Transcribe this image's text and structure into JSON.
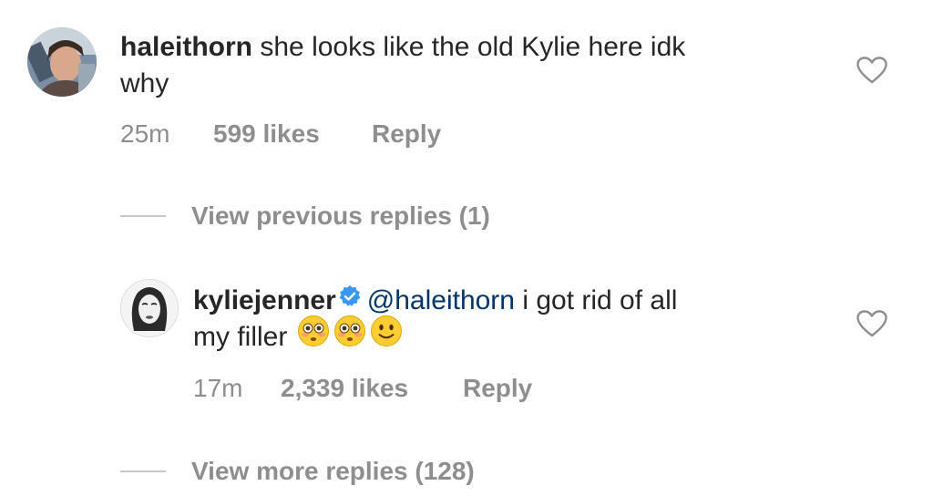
{
  "comments": [
    {
      "username": "haleithorn",
      "text_line1": "she looks like the old Kylie here idk",
      "text_line2": "why",
      "time": "25m",
      "likes": "599 likes",
      "reply": "Reply",
      "avatar_icon": "avatar-photo"
    },
    {
      "username": "kyliejenner",
      "verified": true,
      "mention": "@haleithorn",
      "text_line1": "i got rid of all",
      "text_line2": "my filler",
      "emojis": [
        "flushed-face",
        "flushed-face",
        "slightly-smiling-face"
      ],
      "time": "17m",
      "likes": "2,339 likes",
      "reply": "Reply",
      "avatar_icon": "avatar-illustration"
    }
  ],
  "view_previous": "View previous replies (1)",
  "view_more": "View more replies (128)",
  "colors": {
    "text": "#262626",
    "secondary": "#8e8e8e",
    "mention": "#003569",
    "verified": "#3897f0",
    "divider": "#c7c7c7"
  }
}
